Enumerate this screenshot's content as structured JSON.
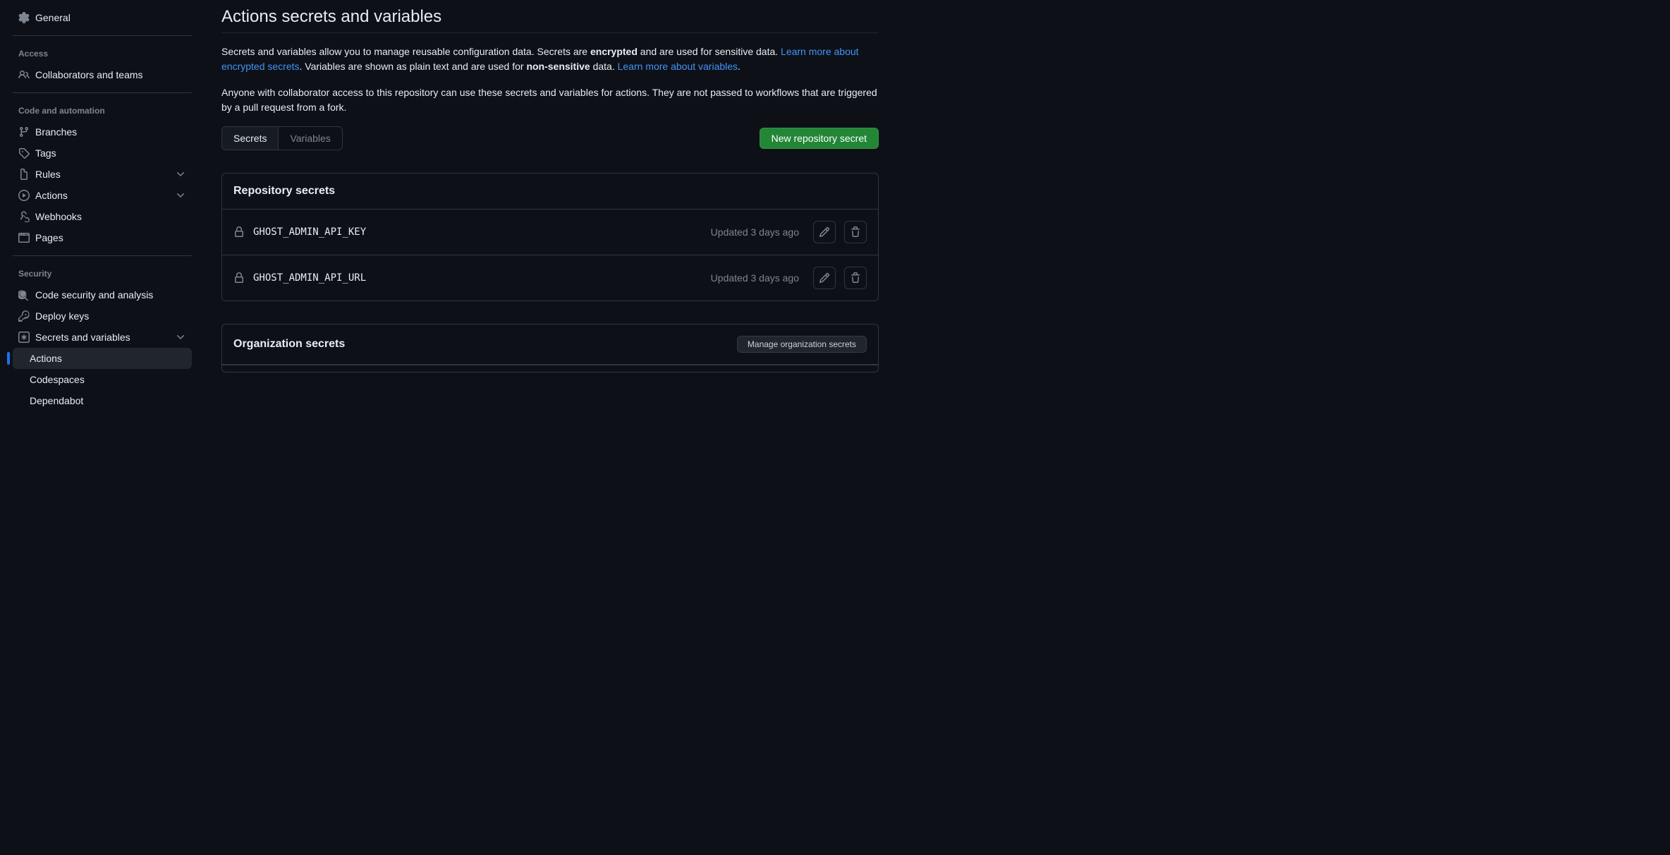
{
  "sidebar": {
    "general": "General",
    "access_heading": "Access",
    "collaborators": "Collaborators and teams",
    "code_automation_heading": "Code and automation",
    "branches": "Branches",
    "tags": "Tags",
    "rules": "Rules",
    "actions": "Actions",
    "webhooks": "Webhooks",
    "pages": "Pages",
    "security_heading": "Security",
    "code_security": "Code security and analysis",
    "deploy_keys": "Deploy keys",
    "secrets_variables": "Secrets and variables",
    "sub_actions": "Actions",
    "sub_codespaces": "Codespaces",
    "sub_dependabot": "Dependabot"
  },
  "main": {
    "title": "Actions secrets and variables",
    "desc_part1": "Secrets and variables allow you to manage reusable configuration data. Secrets are ",
    "desc_encrypted": "encrypted",
    "desc_part2": " and are used for sensitive data. ",
    "link_secrets": "Learn more about encrypted secrets",
    "desc_part3": ". Variables are shown as plain text and are used for ",
    "desc_nonsensitive": "non-sensitive",
    "desc_part4": " data. ",
    "link_variables": "Learn more about variables",
    "desc_part5": ".",
    "desc_para2": "Anyone with collaborator access to this repository can use these secrets and variables for actions. They are not passed to workflows that are triggered by a pull request from a fork.",
    "tab_secrets": "Secrets",
    "tab_variables": "Variables",
    "btn_new_secret": "New repository secret",
    "repo_secrets_heading": "Repository secrets",
    "org_secrets_heading": "Organization secrets",
    "btn_manage_org": "Manage organization secrets",
    "secrets": [
      {
        "name": "GHOST_ADMIN_API_KEY",
        "updated": "Updated 3 days ago"
      },
      {
        "name": "GHOST_ADMIN_API_URL",
        "updated": "Updated 3 days ago"
      }
    ]
  }
}
